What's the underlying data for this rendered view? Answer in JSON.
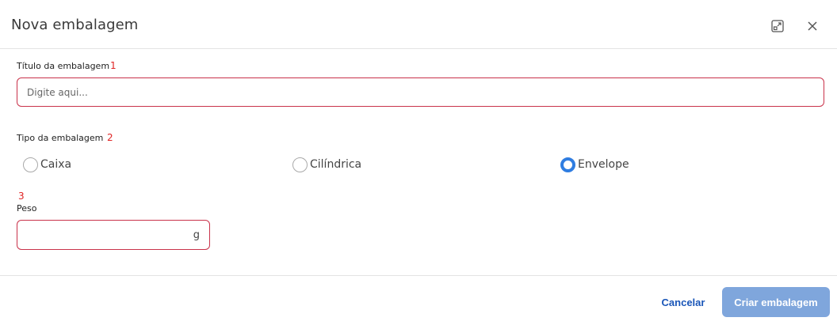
{
  "dialog": {
    "title": "Nova embalagem",
    "expand_icon": "expand-icon",
    "close_icon": "close-icon"
  },
  "fields": {
    "title": {
      "label": "Título da embalagem",
      "step": "1",
      "placeholder": "Digite aqui...",
      "value": ""
    },
    "type": {
      "label": "Tipo da embalagem",
      "step": "2",
      "options": [
        "Caixa",
        "Cilíndrica",
        "Envelope"
      ],
      "selected": "Envelope"
    },
    "weight": {
      "step": "3",
      "label": "Peso",
      "value": "",
      "unit": "g"
    }
  },
  "footer": {
    "cancel_label": "Cancelar",
    "create_label": "Criar embalagem"
  },
  "colors": {
    "accent": "#2f7de1",
    "error_border": "#c9324a",
    "primary_disabled": "#7fa6dc",
    "link": "#1a56b8"
  }
}
